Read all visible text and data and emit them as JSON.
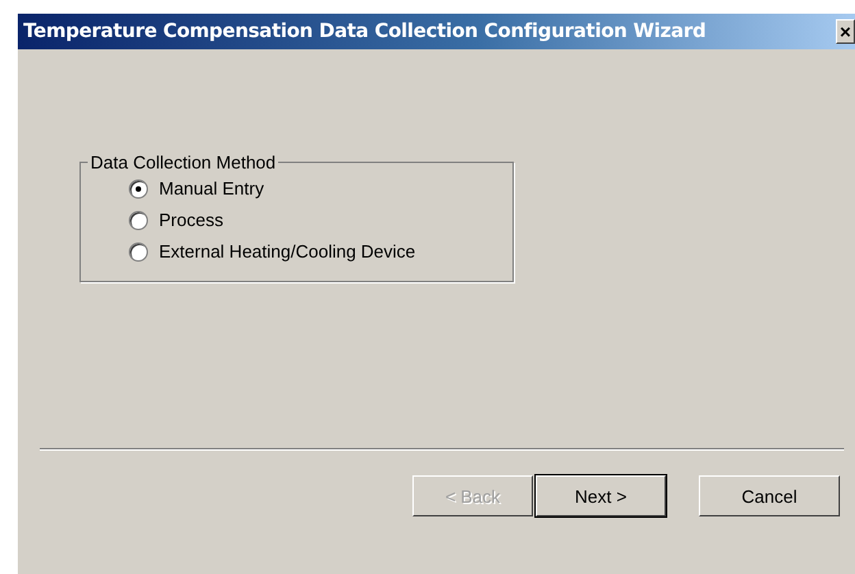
{
  "window": {
    "title": "Temperature Compensation Data Collection Configuration Wizard",
    "close": "×"
  },
  "group": {
    "label": "Data Collection Method",
    "options": [
      {
        "label": "Manual Entry",
        "selected": true
      },
      {
        "label": "Process",
        "selected": false
      },
      {
        "label": "External Heating/Cooling Device",
        "selected": false
      }
    ]
  },
  "buttons": [
    {
      "label": "< Back",
      "disabled": true,
      "default": false
    },
    {
      "label": "Next >",
      "disabled": false,
      "default": true
    },
    {
      "label": "Cancel",
      "disabled": false,
      "default": false
    }
  ]
}
